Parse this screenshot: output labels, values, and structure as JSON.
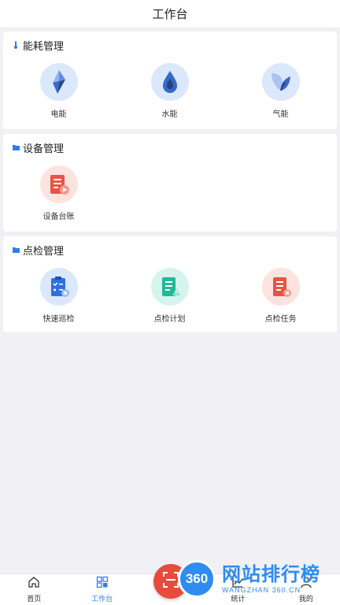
{
  "header": {
    "title": "工作台"
  },
  "sections": [
    {
      "title": "能耗管理",
      "items": [
        {
          "label": "电能",
          "icon": "electricity-icon"
        },
        {
          "label": "水能",
          "icon": "water-drop-icon"
        },
        {
          "label": "气能",
          "icon": "leaf-gas-icon"
        }
      ]
    },
    {
      "title": "设备管理",
      "items": [
        {
          "label": "设备台账",
          "icon": "device-ledger-icon"
        }
      ]
    },
    {
      "title": "点检管理",
      "items": [
        {
          "label": "快速巡检",
          "icon": "quick-inspection-icon"
        },
        {
          "label": "点检计划",
          "icon": "inspection-plan-icon"
        },
        {
          "label": "点检任务",
          "icon": "inspection-task-icon"
        }
      ]
    }
  ],
  "tabbar": {
    "items": [
      {
        "label": "首页",
        "icon": "home-icon"
      },
      {
        "label": "工作台",
        "icon": "grid-icon",
        "active": true
      },
      {
        "label": "",
        "icon": "scan-icon"
      },
      {
        "label": "统计",
        "icon": "chart-icon"
      },
      {
        "label": "我的",
        "icon": "user-icon"
      }
    ]
  },
  "watermark": {
    "logo": "360",
    "cn": "网站排行榜",
    "en": "WANGZHAN 360.CN"
  },
  "colors": {
    "accent": "#2f7cf6",
    "danger": "#e64b3c",
    "teal": "#2ec4a8"
  }
}
